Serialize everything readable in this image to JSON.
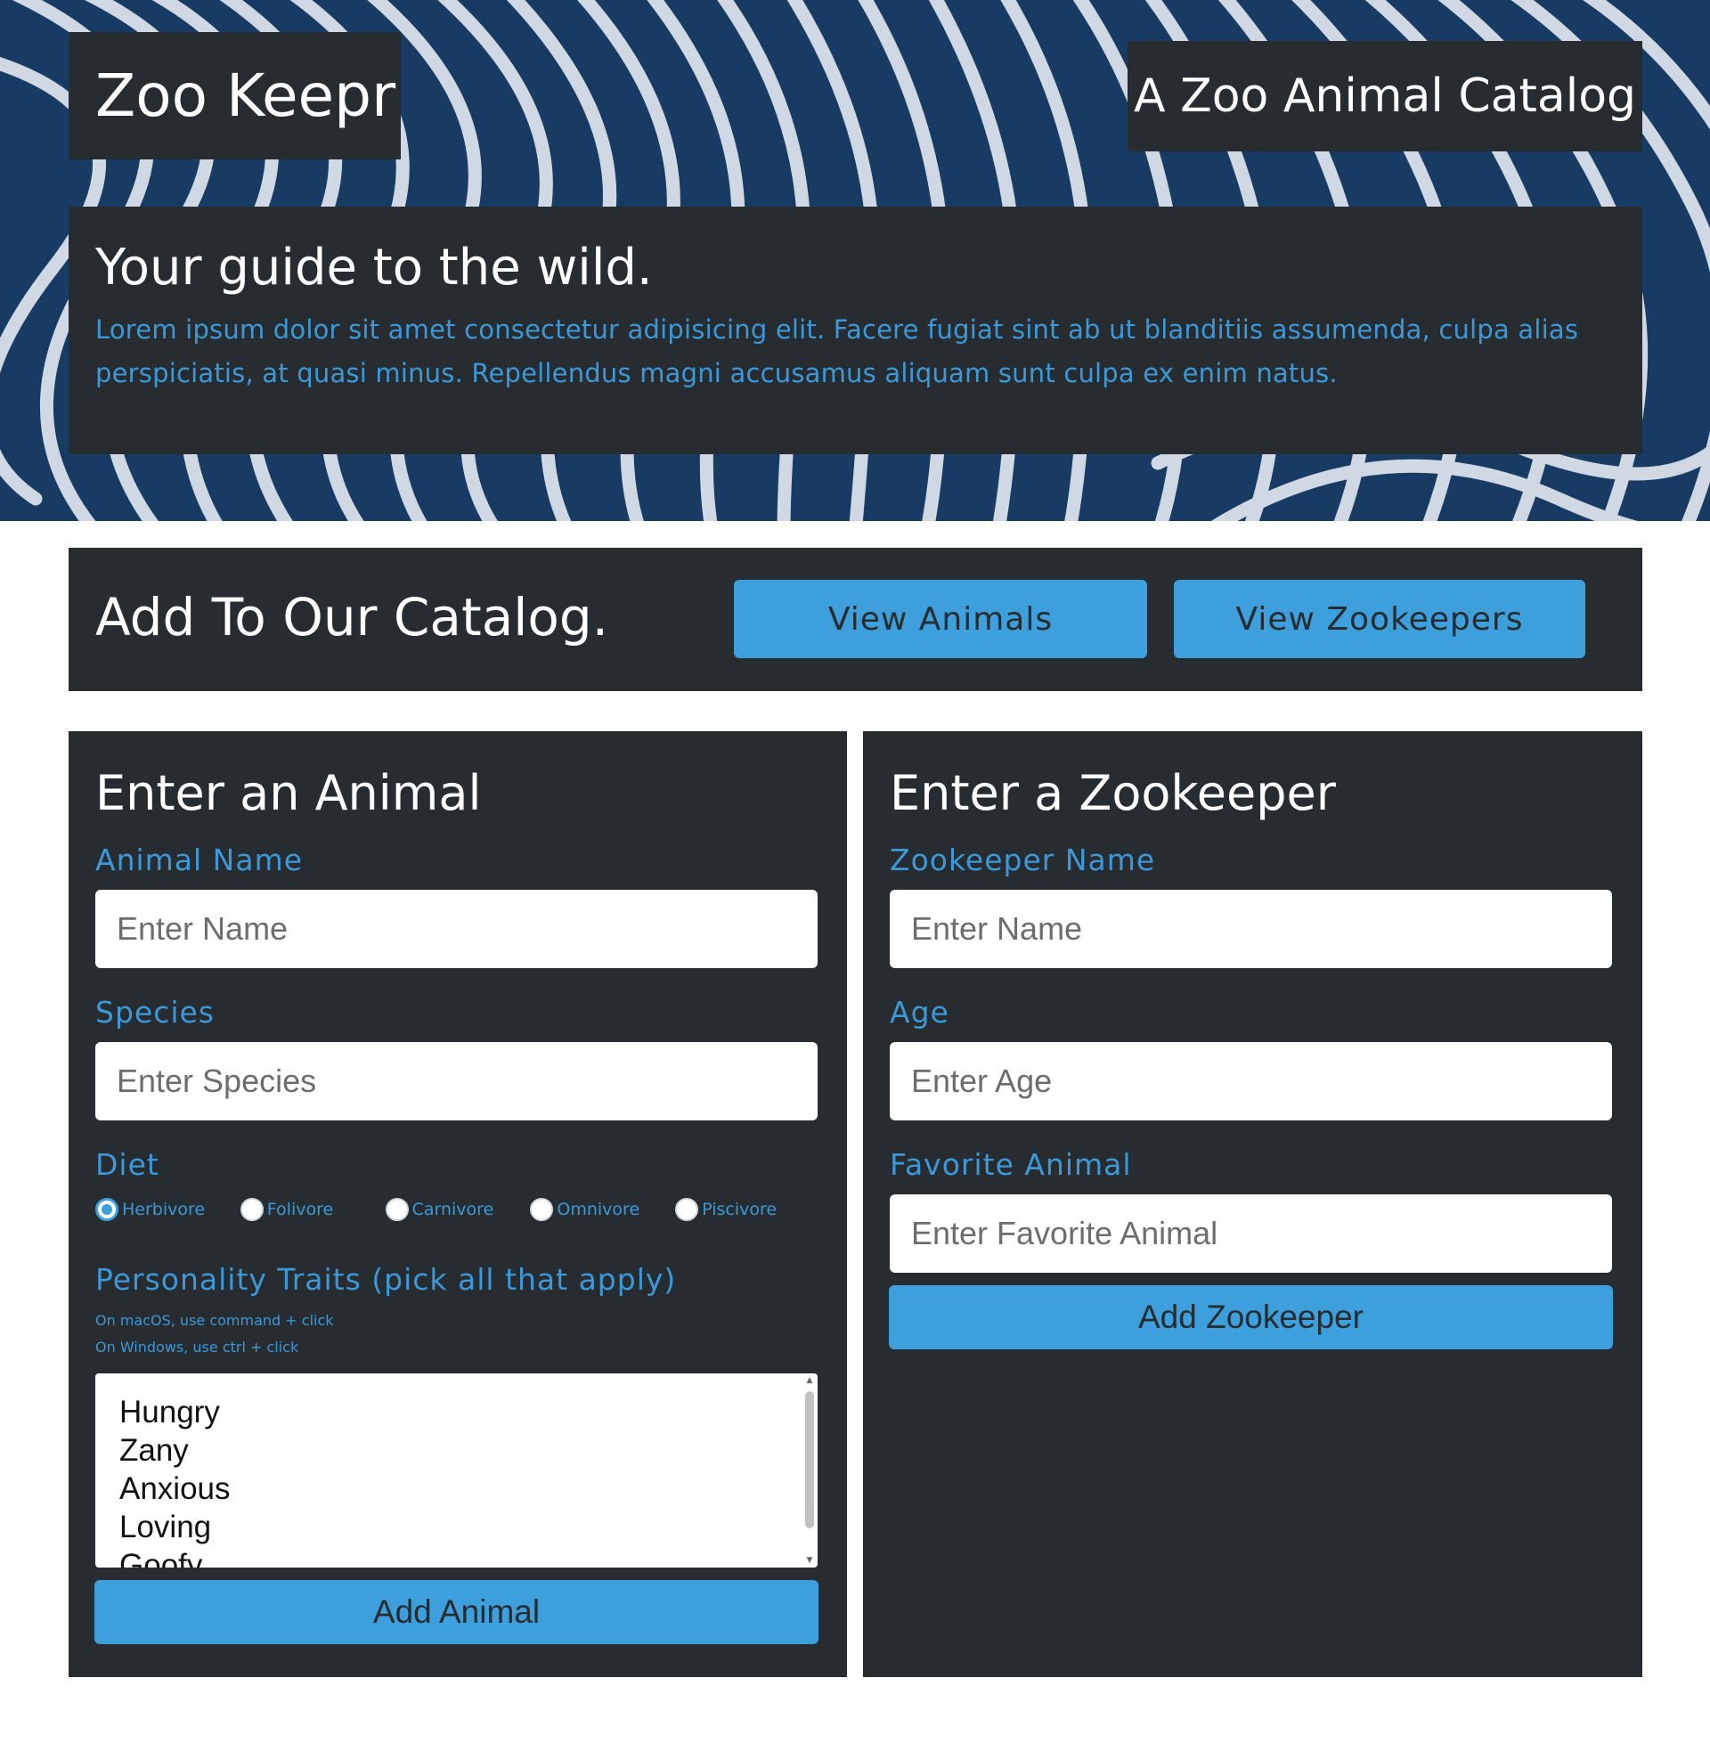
{
  "header": {
    "brand": "Zoo Keepr",
    "tagline": "A Zoo Animal Catalog"
  },
  "intro": {
    "heading": "Your guide to the wild.",
    "body": "Lorem ipsum dolor sit amet consectetur adipisicing elit. Facere fugiat sint ab ut blanditiis assumenda, culpa alias perspiciatis, at quasi minus. Repellendus magni accusamus aliquam sunt culpa ex enim natus."
  },
  "actions": {
    "heading": "Add To Our Catalog.",
    "view_animals": "View Animals",
    "view_zookeepers": "View Zookeepers"
  },
  "animal_form": {
    "title": "Enter an Animal",
    "name_label": "Animal Name",
    "name_placeholder": "Enter Name",
    "species_label": "Species",
    "species_placeholder": "Enter Species",
    "diet_label": "Diet",
    "diet_options": [
      "Herbivore",
      "Folivore",
      "Carnivore",
      "Omnivore",
      "Piscivore"
    ],
    "diet_selected": "Herbivore",
    "traits_label": "Personality Traits (pick all that apply)",
    "hint_mac": "On macOS, use command + click",
    "hint_windows": "On Windows, use ctrl + click",
    "traits": [
      "Hungry",
      "Zany",
      "Anxious",
      "Loving",
      "Goofy"
    ],
    "submit": "Add Animal"
  },
  "zookeeper_form": {
    "title": "Enter a Zookeeper",
    "name_label": "Zookeeper Name",
    "name_placeholder": "Enter Name",
    "age_label": "Age",
    "age_placeholder": "Enter Age",
    "favorite_label": "Favorite Animal",
    "favorite_placeholder": "Enter Favorite Animal",
    "submit": "Add Zookeeper"
  },
  "colors": {
    "panel": "#262c30",
    "accent": "#3d9fdb",
    "label": "#3d98d8",
    "hero": "#173b63"
  }
}
